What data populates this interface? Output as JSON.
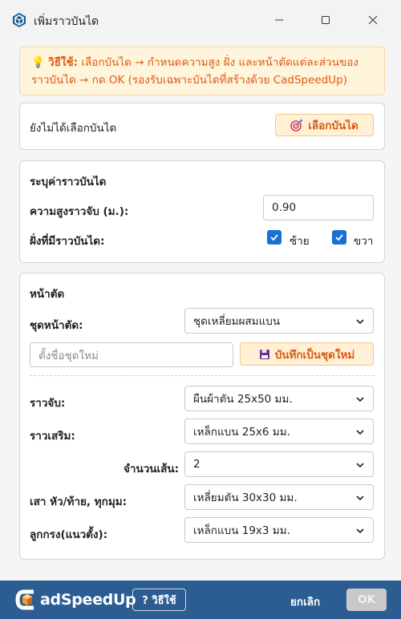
{
  "window": {
    "title": "เพิ่มราวบันได",
    "app_icon": "sketchup-icon",
    "controls": [
      "minimize-icon",
      "maximize-icon",
      "close-icon"
    ]
  },
  "tip": {
    "icon": "lightbulb-icon",
    "label": "วิธีใช้:",
    "text": " เลือกบันได → กำหนดความสูง ฝั่ง และหน้าตัดแต่ละส่วนของราวบันได → กด OK (รองรับเฉพาะบันไดที่สร้างด้วย CadSpeedUp)"
  },
  "stair_section": {
    "status": "ยังไม่ได้เลือกบันได",
    "select_button": "เลือกบันได",
    "select_icon": "target-icon"
  },
  "railing_section": {
    "title": "ระบุค่าราวบันได",
    "height_label": "ความสูงราวจับ (ม.):",
    "height_value": "0.90",
    "side_label": "ฝั่งที่มีราวบันได:",
    "left_label": "ซ้าย",
    "left_checked": true,
    "right_label": "ขวา",
    "right_checked": true
  },
  "profile_section": {
    "title": "หน้าตัด",
    "set_label": "ชุดหน้าตัด:",
    "set_value": "ชุดเหลี่ยมผสมแบน",
    "new_set_placeholder": "ตั้งชื่อชุดใหม่",
    "save_button": "บันทึกเป็นชุดใหม่",
    "save_icon": "floppy-disk-icon",
    "handrail_label": "ราวจับ:",
    "handrail_value": "ผืนผ้าตัน 25x50 มม.",
    "midrail_label": "ราวเสริม:",
    "midrail_value": "เหล็กแบน 25x6 มม.",
    "count_label": "จำนวนเส้น:",
    "count_value": "2",
    "post_label": "เสา หัว/ท้าย, ทุกมุม:",
    "post_value": "เหลี่ยมตัน 30x30 มม.",
    "baluster_label": "ลูกกรง(แนวตั้ง):",
    "baluster_value": "เหล็กแบน 19x3 มม."
  },
  "footer": {
    "brand": "adSpeedUp",
    "help_button": "? วิธีใช้",
    "cancel_button": "ยกเลิก",
    "ok_button": "OK"
  },
  "colors": {
    "accent_orange": "#e05a12",
    "tip_bg": "#fff4dc",
    "footer_bg": "#2b5d93",
    "checkbox": "#1a6fd4",
    "ok_disabled": "#c9c9c9"
  }
}
